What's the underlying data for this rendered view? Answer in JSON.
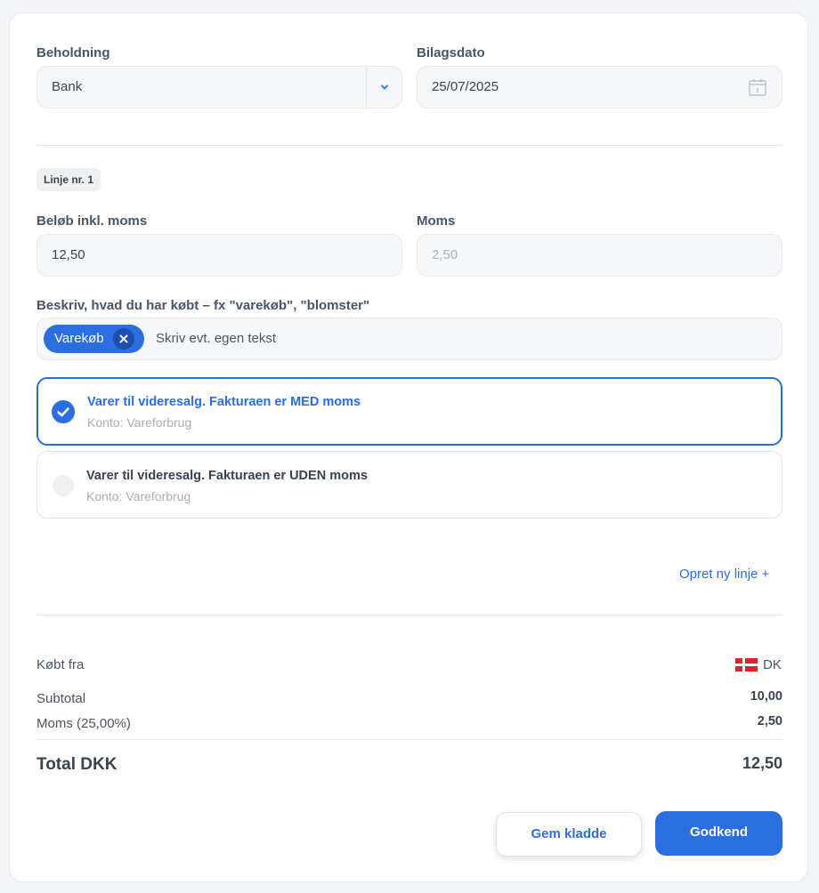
{
  "colors": {
    "accent": "#2b6ee0",
    "accent_dark": "#1c4fb0",
    "text": "#2d3748",
    "muted": "#a8aeb6",
    "flag_red": "#d7262f"
  },
  "beholdning": {
    "label": "Beholdning",
    "value": "Bank"
  },
  "bilagsdato": {
    "label": "Bilagsdato",
    "value": "25/07/2025"
  },
  "line_badge": "Linje nr. 1",
  "belob": {
    "label": "Beløb inkl. moms",
    "value": "12,50"
  },
  "moms": {
    "label": "Moms",
    "value": "2,50"
  },
  "description": {
    "label": "Beskriv, hvad du har købt – fx \"varekøb\", \"blomster\"",
    "tag": "Varekøb",
    "placeholder": "Skriv evt. egen tekst"
  },
  "options": [
    {
      "title": "Varer til videresalg. Fakturaen er MED moms",
      "subtitle": "Konto: Vareforbrug",
      "selected": true
    },
    {
      "title": "Varer til videresalg. Fakturaen er UDEN moms",
      "subtitle": "Konto: Vareforbrug",
      "selected": false
    }
  ],
  "new_line_link": "Opret ny linje +",
  "summary": {
    "bought_from_label": "Købt fra",
    "bought_from_value": "DK",
    "subtotal_label": "Subtotal",
    "subtotal_value": "10,00",
    "moms_label": "Moms (25,00%)",
    "moms_value": "2,50",
    "total_label": "Total DKK",
    "total_value": "12,50"
  },
  "buttons": {
    "draft": "Gem kladde",
    "approve": "Godkend"
  },
  "icons": {
    "dropdown": "chevron-down-icon",
    "calendar": "calendar-icon",
    "remove_tag": "close-icon",
    "check": "check-icon",
    "flag": "denmark-flag-icon"
  }
}
